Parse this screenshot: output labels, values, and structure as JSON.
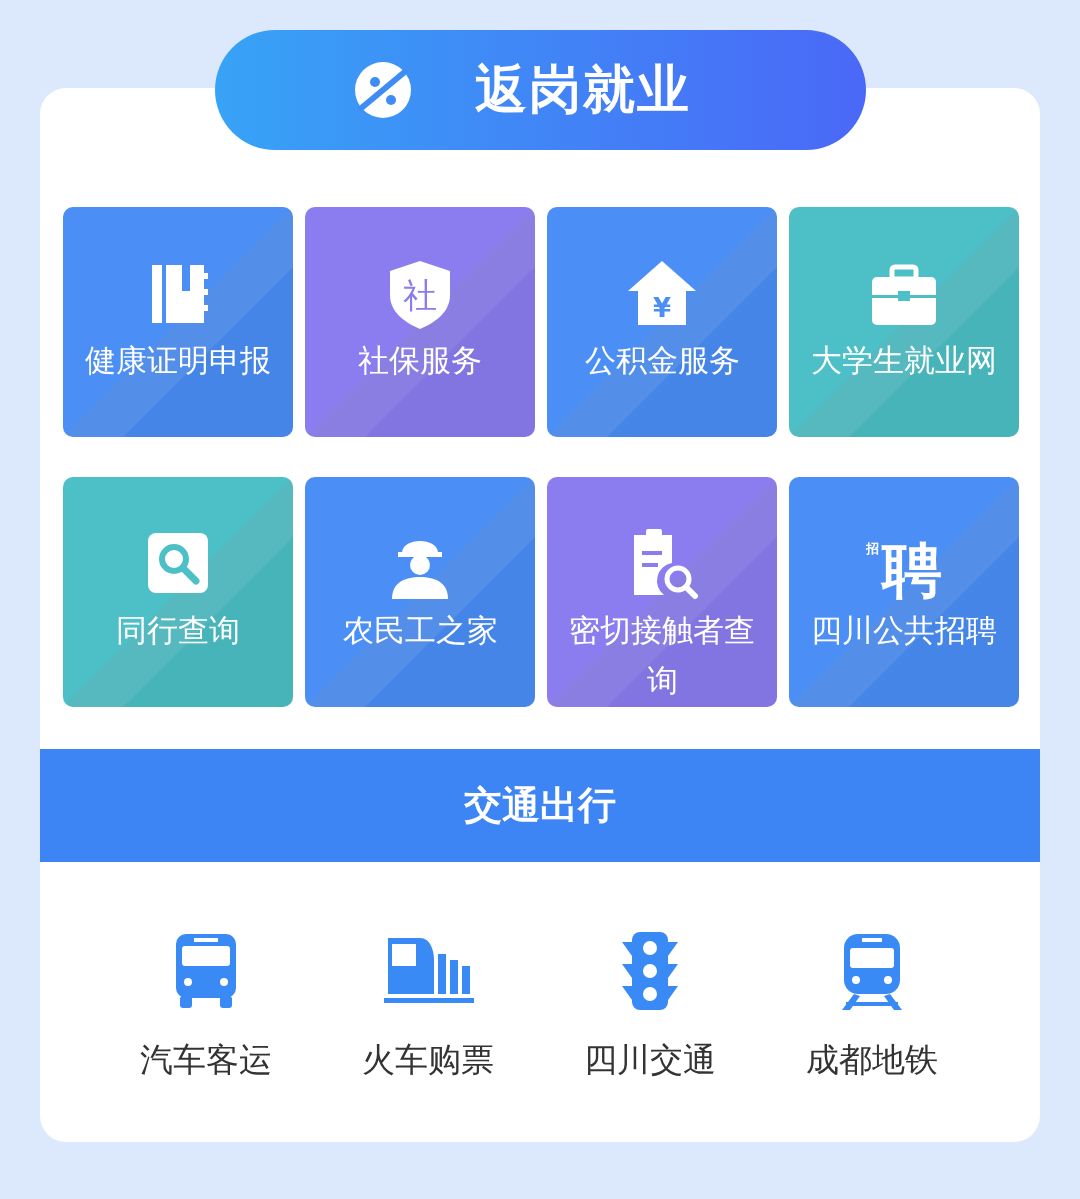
{
  "header": {
    "title": "返岗就业"
  },
  "tiles": [
    {
      "label": "健康证明申报",
      "color": "#4a8ef6",
      "kind": "notebook"
    },
    {
      "label": "社保服务",
      "color": "#8b7cf0",
      "kind": "shield",
      "icon_text": "社"
    },
    {
      "label": "公积金服务",
      "color": "#4a8ef6",
      "kind": "house",
      "icon_text": "¥"
    },
    {
      "label": "大学生就业网",
      "color": "#4cc0c6",
      "kind": "briefcase"
    },
    {
      "label": "同行查询",
      "color": "#4cc0c6",
      "kind": "search"
    },
    {
      "label": "农民工之家",
      "color": "#4a8ef6",
      "kind": "worker"
    },
    {
      "label": "密切接触者查询",
      "color": "#8b7cf0",
      "kind": "document"
    },
    {
      "label": "四川公共招聘",
      "color": "#4a8ef6",
      "kind": "hire",
      "icon_text": "聘",
      "icon_subtext": "招"
    }
  ],
  "section": {
    "title": "交通出行"
  },
  "transport": [
    {
      "label": "汽车客运",
      "kind": "bus"
    },
    {
      "label": "火车购票",
      "kind": "train"
    },
    {
      "label": "四川交通",
      "kind": "traffic-light"
    },
    {
      "label": "成都地铁",
      "kind": "metro"
    }
  ]
}
